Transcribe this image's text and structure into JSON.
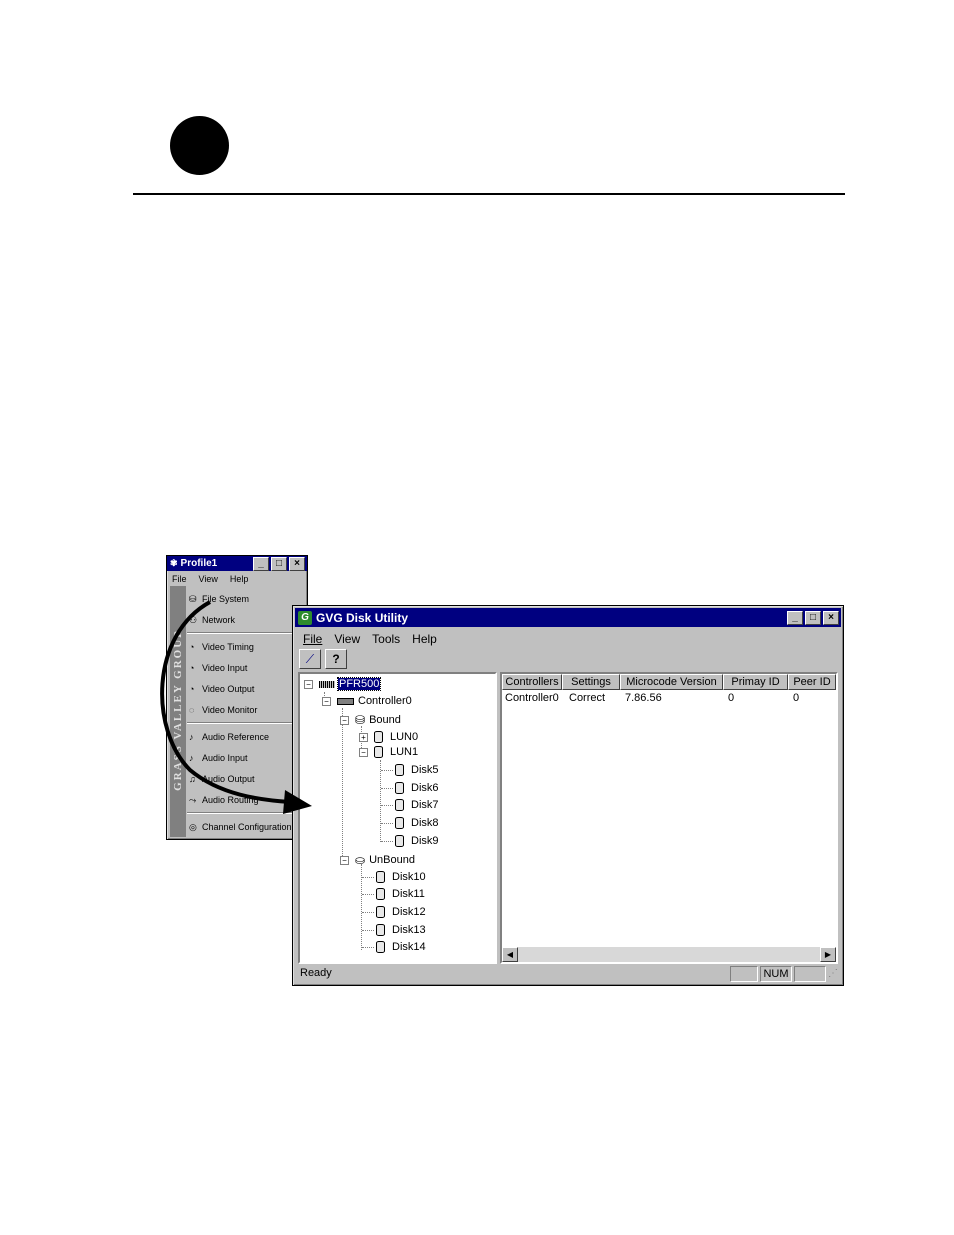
{
  "profile": {
    "title": "Profile1",
    "menu": [
      "File",
      "View",
      "Help"
    ],
    "brand": "GRASS VALLEY GROUP",
    "items": [
      {
        "label": "File System",
        "icon": "disk-icon"
      },
      {
        "label": "Network",
        "icon": "network-icon"
      },
      {
        "label": "Video Timing",
        "icon": "video-timing-icon"
      },
      {
        "label": "Video Input",
        "icon": "video-input-icon"
      },
      {
        "label": "Video Output",
        "icon": "video-output-icon"
      },
      {
        "label": "Video Monitor",
        "icon": "video-monitor-icon"
      },
      {
        "label": "Audio Reference",
        "icon": "audio-reference-icon"
      },
      {
        "label": "Audio Input",
        "icon": "audio-input-icon"
      },
      {
        "label": "Audio Output",
        "icon": "audio-output-icon"
      },
      {
        "label": "Audio Routing",
        "icon": "audio-routing-icon"
      },
      {
        "label": "Channel Configuration",
        "icon": "channel-config-icon"
      }
    ]
  },
  "disk_utility": {
    "title": "GVG Disk Utility",
    "logo": "G",
    "menu": [
      "File",
      "View",
      "Tools",
      "Help"
    ],
    "tree": {
      "root": "PFR500",
      "controller": "Controller0",
      "bound": "Bound",
      "lun0": "LUN0",
      "lun1": "LUN1",
      "lun1_disks": [
        "Disk5",
        "Disk6",
        "Disk7",
        "Disk8",
        "Disk9"
      ],
      "unbound": "UnBound",
      "unbound_disks": [
        "Disk10",
        "Disk11",
        "Disk12",
        "Disk13",
        "Disk14"
      ]
    },
    "columns": [
      "Controllers",
      "Settings",
      "Microcode Version",
      "Primay ID",
      "Peer ID"
    ],
    "rows": [
      [
        "Controller0",
        "Correct",
        "7.86.56",
        "0",
        "0"
      ]
    ],
    "status": "Ready",
    "status_num": "NUM"
  }
}
